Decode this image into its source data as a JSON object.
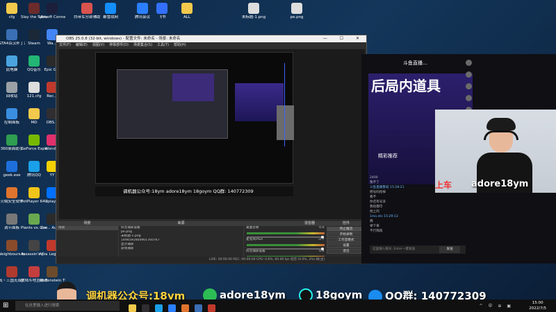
{
  "desktop": {
    "icons": [
      {
        "label": "cfg",
        "color": "#f2c94c"
      },
      {
        "label": "GTA4百汉补丁2022…",
        "color": "#3a6fb5"
      },
      {
        "label": "此电脑",
        "color": "#4aa3df"
      },
      {
        "label": "回收站",
        "color": "#9aa0a6"
      },
      {
        "label": "控制面板",
        "color": "#3a8ee0"
      },
      {
        "label": "360桌面助手",
        "color": "#2e9e4f"
      },
      {
        "label": "geek.exe",
        "color": "#1e6fd9"
      },
      {
        "label": "火绒安全软件",
        "color": "#e0742e"
      },
      {
        "label": "调节面板",
        "color": "#777777"
      },
      {
        "label": "Neighbours back From…",
        "color": "#8a4b2b"
      },
      {
        "label": "真・三国无双7 with 猛…",
        "color": "#b03a2e"
      },
      {
        "label": "Slay the Spire",
        "color": "#6b2b2b"
      },
      {
        "label": "Steam",
        "color": "#1b2838"
      },
      {
        "label": "QQ音乐",
        "color": "#22b573"
      },
      {
        "label": "121.cfg",
        "color": "#dddddd"
      },
      {
        "label": "MD",
        "color": "#f2c94c"
      },
      {
        "label": "GeForce Experience",
        "color": "#76b900"
      },
      {
        "label": "腾讯QQ",
        "color": "#1aa0e8"
      },
      {
        "label": "PotPlayer 64 bit",
        "color": "#f0c418"
      },
      {
        "label": "Plants vs. Zombies G…",
        "color": "#6aa84f"
      },
      {
        "label": "Assassin's Creed O…",
        "color": "#444444"
      },
      {
        "label": "欧陆斗地主修改器",
        "color": "#c43e3e"
      },
      {
        "label": "Ubisoft Connect",
        "color": "#1b1f3b"
      },
      {
        "label": "Wa…",
        "color": "#4285f4"
      },
      {
        "label": "Epic G…",
        "color": "#2a2a2a"
      },
      {
        "label": "Rec…",
        "color": "#c0392b"
      },
      {
        "label": "OBS…",
        "color": "#302e31"
      },
      {
        "label": "Wond…",
        "color": "#e1306c"
      },
      {
        "label": "YY",
        "color": "#f5d100"
      },
      {
        "label": "Uplay…",
        "color": "#0070ff"
      },
      {
        "label": "Gra… Auto…",
        "color": "#2b2b2b"
      },
      {
        "label": "Ap… Legends",
        "color": "#c0392b"
      },
      {
        "label": "Wolfenstein The Old B…",
        "color": "#6b4b2b"
      },
      {
        "label": "白帝军分部辅助",
        "color": "#d9534f"
      },
      {
        "label": "暴雪战网",
        "color": "#148eff"
      },
      {
        "label": "腾讯会议",
        "color": "#2b7fff"
      },
      {
        "label": "飞书",
        "color": "#3370ff"
      },
      {
        "label": "ALL",
        "color": "#f2c94c"
      },
      {
        "label": "未标题-1.png",
        "color": "#dddddd"
      },
      {
        "label": "pe.png",
        "color": "#dddddd"
      }
    ]
  },
  "obs": {
    "title": "OBS 25.0.8 (32-bit, windows) - 配置文件: 未命名 - 场景: 未命名",
    "window_buttons": "—  ☐  ✕",
    "menu": [
      "文件(F)",
      "编辑(E)",
      "视图(V)",
      "停靠部件(D)",
      "场景集合(S)",
      "工具(T)",
      "帮助(H)"
    ],
    "preview_overlay_text": "调机器公众号:18ym   adore18ym   18goym   QQ群: 140772309",
    "docks": {
      "scenes": {
        "header": "场景",
        "items": [
          "场景"
        ]
      },
      "sources": {
        "header": "来源",
        "items": [
          "抖音捕获设备",
          "pe.png",
          "未标题-1.png",
          "1494591664901760767",
          "显示捕获",
          "游戏捕获"
        ]
      },
      "mixer": {
        "header": "混音器",
        "tracks": [
          {
            "name": "桌面音频",
            "level": "0.0 dB"
          },
          {
            "name": "麦克风/Aux",
            "level": "-2.7 dB"
          },
          {
            "name": "抖音捕获设备",
            "level": "0.0 dB"
          }
        ]
      },
      "controls": {
        "header": "控件",
        "buttons": [
          "停止推流",
          "开始录制",
          "工作室模式",
          "设置",
          "退出"
        ]
      },
      "transitions": {
        "labels": [
          "转场特效",
          "淡出"
        ]
      }
    },
    "status": "LIVE: 00:00:00   REC: 00:00:00   CPU: 0.6%, 60.00 fps        延迟 (0.0%, 2%) 帧(主)"
  },
  "stream": {
    "header": "斗鱼直播…",
    "banner_text": "后局内道具",
    "tab_label": "精彩推荐",
    "chat": [
      {
        "text": "2400",
        "blue": false
      },
      {
        "text": "我不了",
        "blue": false
      },
      {
        "text": "斗鱼直播鲁班  15:28:21",
        "blue": true
      },
      {
        "text": "把号码抢掉",
        "blue": false
      },
      {
        "text": "看不",
        "blue": false
      },
      {
        "text": "你还有号没",
        "blue": false
      },
      {
        "text": "我啥都可",
        "blue": false
      },
      {
        "text": "他上的",
        "blue": false
      },
      {
        "text": "1mo.ets  15:29:13",
        "blue": true
      },
      {
        "text": "偶",
        "blue": false
      },
      {
        "text": "举下来",
        "blue": false
      },
      {
        "text": "不行我再",
        "blue": false
      }
    ],
    "input_placeholder": "这里输入聊天, Enter一键发送",
    "send_label": "发送"
  },
  "webcam": {
    "label_left": "上车",
    "wechat_id": "adore18ym"
  },
  "overlay": {
    "gzh": "调机器公众号:18ym",
    "wechat": "adore18ym",
    "douyin": "18goym",
    "qq": "QQ群: 140772309",
    "colors": {
      "wechat": "#2dbd55",
      "douyin": "#111111",
      "qq": "#1b8cf0"
    }
  },
  "taskbar": {
    "search_placeholder": "在这里输入进行搜索",
    "time": "15:00",
    "date": "2022/7/5",
    "tray": "^ 中 ⊕ ▣",
    "app_colors": [
      "#f2c94c",
      "#302e31",
      "#1aa0e8",
      "#2b7fff",
      "#e0742e",
      "#3a6fb5",
      "#c0392b"
    ]
  }
}
